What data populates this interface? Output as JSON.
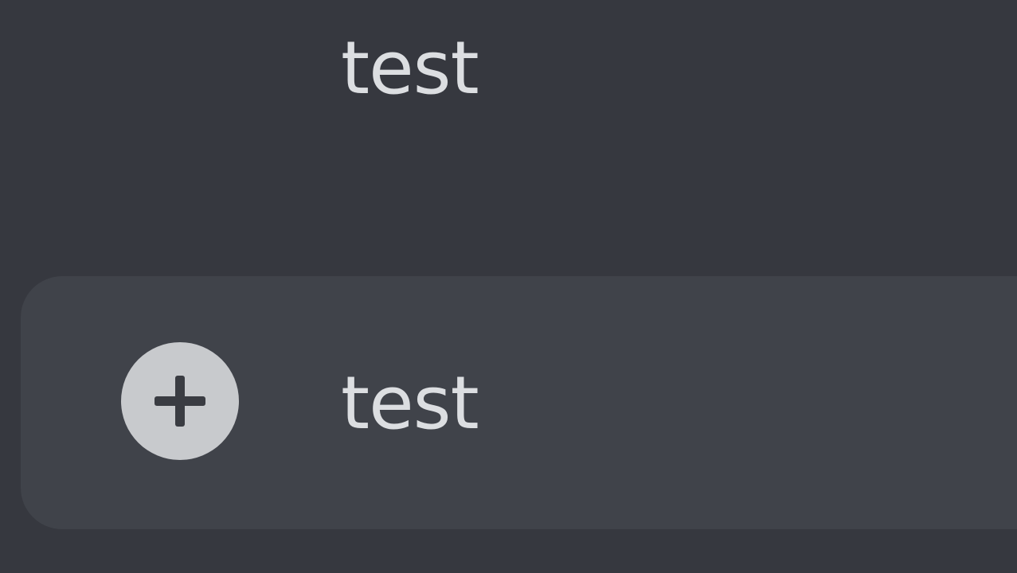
{
  "messages": [
    {
      "text": "test"
    }
  ],
  "composer": {
    "value": "test"
  },
  "colors": {
    "background": "#36383f",
    "composer_background": "#40434a",
    "text": "#dcdee1",
    "plus_circle": "#c8cacd",
    "plus_glyph": "#3a3c42"
  },
  "icons": {
    "attach": "plus-circle-icon"
  }
}
